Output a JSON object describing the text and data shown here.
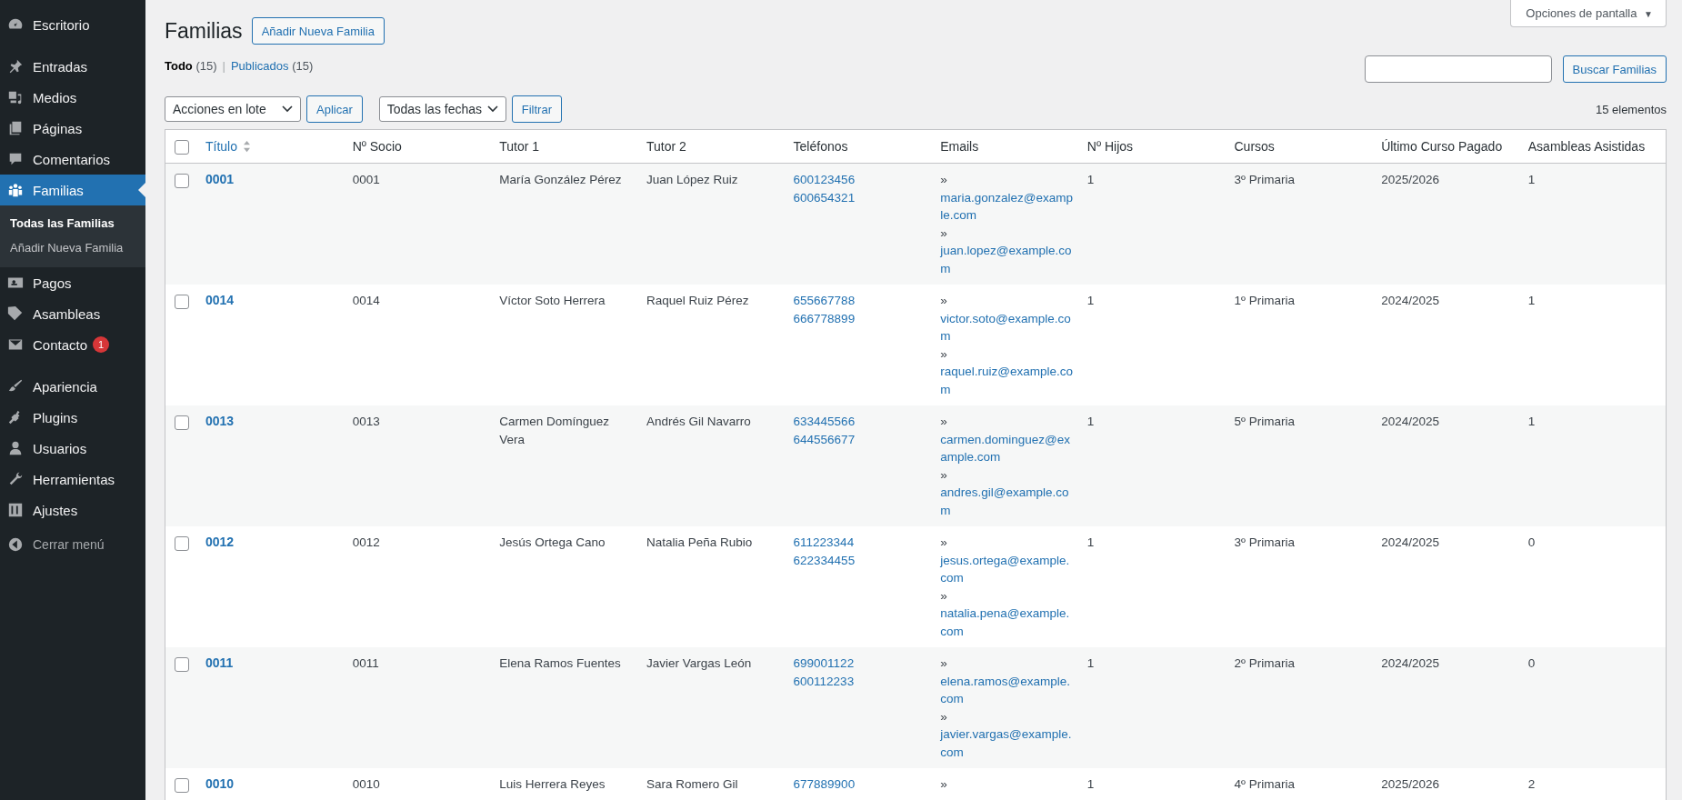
{
  "sidebar": {
    "groups": [
      [
        {
          "label": "Escritorio",
          "selected": false
        }
      ],
      [
        {
          "label": "Entradas",
          "selected": false
        },
        {
          "label": "Medios",
          "selected": false
        },
        {
          "label": "Páginas",
          "selected": false
        },
        {
          "label": "Comentarios",
          "selected": false
        },
        {
          "label": "Familias",
          "selected": true,
          "children": [
            {
              "label": "Todas las Familias",
              "selected": true
            },
            {
              "label": "Añadir Nueva Familia",
              "selected": false
            }
          ]
        },
        {
          "label": "Pagos",
          "selected": false
        },
        {
          "label": "Asambleas",
          "selected": false
        },
        {
          "label": "Contacto",
          "selected": false,
          "badge": "1"
        }
      ],
      [
        {
          "label": "Apariencia",
          "selected": false
        },
        {
          "label": "Plugins",
          "selected": false
        },
        {
          "label": "Usuarios",
          "selected": false
        },
        {
          "label": "Herramientas",
          "selected": false
        },
        {
          "label": "Ajustes",
          "selected": false
        }
      ]
    ],
    "collapse": "Cerrar menú"
  },
  "screen_options": "Opciones de pantalla",
  "screen_options_caret": "▼",
  "page_title": "Familias",
  "add_button": "Añadir Nueva Familia",
  "views": [
    {
      "label": "Todo",
      "count": "(15)",
      "selected": true
    },
    {
      "label": "Publicados",
      "count": "(15)",
      "selected": false
    }
  ],
  "views_separator": "|",
  "search": {
    "button": "Buscar Familias"
  },
  "bulk_actions": {
    "value": "Acciones en lote",
    "button": "Aplicar"
  },
  "date_filter": {
    "value": "Todas las fechas",
    "button": "Filtrar"
  },
  "item_count": "15 elementos",
  "table": {
    "select_all": {
      "checked": false
    },
    "columns": [
      {
        "label": "Título",
        "sortable": true
      },
      {
        "label": "Nº Socio",
        "sortable": false
      },
      {
        "label": "Tutor 1",
        "sortable": false
      },
      {
        "label": "Tutor 2",
        "sortable": false
      },
      {
        "label": "Teléfonos",
        "sortable": false
      },
      {
        "label": "Emails",
        "sortable": false
      },
      {
        "label": "Nº Hijos",
        "sortable": false
      },
      {
        "label": "Cursos",
        "sortable": false
      },
      {
        "label": "Último Curso Pagado",
        "sortable": false
      },
      {
        "label": "Asambleas Asistidas",
        "sortable": false
      }
    ],
    "rows": [
      {
        "checked": false,
        "title": "0001",
        "socio": "0001",
        "tutor1": "María González Pérez",
        "tutor2": "Juan López Ruiz",
        "phones": [
          "600123456",
          "600654321"
        ],
        "emails": [
          {
            "marker": "»",
            "address": "maria.gonzalez@example.com"
          },
          {
            "marker": "»",
            "address": "juan.lopez@example.com"
          }
        ],
        "hijos": "1",
        "curso": "3º Primaria",
        "pagado": "2025/2026",
        "asambleas": "1"
      },
      {
        "checked": false,
        "title": "0014",
        "socio": "0014",
        "tutor1": "Víctor Soto Herrera",
        "tutor2": "Raquel Ruiz Pérez",
        "phones": [
          "655667788",
          "666778899"
        ],
        "emails": [
          {
            "marker": "»",
            "address": "victor.soto@example.com"
          },
          {
            "marker": "»",
            "address": "raquel.ruiz@example.com"
          }
        ],
        "hijos": "1",
        "curso": "1º Primaria",
        "pagado": "2024/2025",
        "asambleas": "1"
      },
      {
        "checked": false,
        "title": "0013",
        "socio": "0013",
        "tutor1": "Carmen Domínguez Vera",
        "tutor2": "Andrés Gil Navarro",
        "phones": [
          "633445566",
          "644556677"
        ],
        "emails": [
          {
            "marker": "»",
            "address": "carmen.dominguez@example.com"
          },
          {
            "marker": "»",
            "address": "andres.gil@example.com"
          }
        ],
        "hijos": "1",
        "curso": "5º Primaria",
        "pagado": "2024/2025",
        "asambleas": "1"
      },
      {
        "checked": false,
        "title": "0012",
        "socio": "0012",
        "tutor1": "Jesús Ortega Cano",
        "tutor2": "Natalia Peña Rubio",
        "phones": [
          "611223344",
          "622334455"
        ],
        "emails": [
          {
            "marker": "»",
            "address": "jesus.ortega@example.com"
          },
          {
            "marker": "»",
            "address": "natalia.pena@example.com"
          }
        ],
        "hijos": "1",
        "curso": "3º Primaria",
        "pagado": "2024/2025",
        "asambleas": "0"
      },
      {
        "checked": false,
        "title": "0011",
        "socio": "0011",
        "tutor1": "Elena Ramos Fuentes",
        "tutor2": "Javier Vargas León",
        "phones": [
          "699001122",
          "600112233"
        ],
        "emails": [
          {
            "marker": "»",
            "address": "elena.ramos@example.com"
          },
          {
            "marker": "»",
            "address": "javier.vargas@example.com"
          }
        ],
        "hijos": "1",
        "curso": "2º Primaria",
        "pagado": "2024/2025",
        "asambleas": "0"
      },
      {
        "checked": false,
        "title": "0010",
        "socio": "0010",
        "tutor1": "Luis Herrera Reyes",
        "tutor2": "Sara Romero Gil",
        "phones": [
          "677889900"
        ],
        "emails": [
          {
            "marker": "»"
          }
        ],
        "hijos": "1",
        "curso": "4º Primaria",
        "pagado": "2025/2026",
        "asambleas": "2"
      }
    ]
  }
}
